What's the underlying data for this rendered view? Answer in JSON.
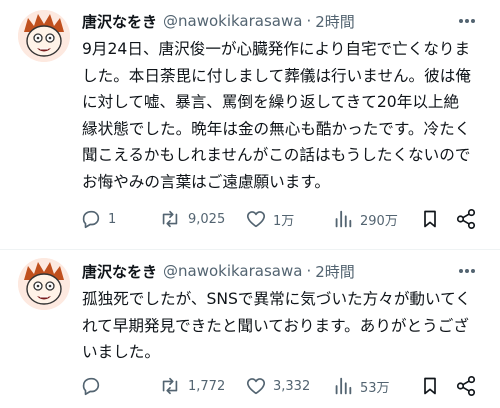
{
  "tweets": [
    {
      "name": "唐沢なをき",
      "handle": "@nawokikarasawa",
      "separator": "·",
      "time": "2時間",
      "text": "9月24日、唐沢俊一が心臓発作により自宅で亡くなりました。本日荼毘に付しまして葬儀は行いません。彼は俺に対して嘘、暴言、罵倒を繰り返してきて20年以上絶縁状態でした。晩年は金の無心も酷かったです。冷たく聞こえるかもしれませんがこの話はもうしたくないのでお悔やみの言葉はご遠慮願います。",
      "lines": [
        "9月24日、唐沢俊一が心臓発作により自宅で亡くなりま",
        "した。本日荼毘に付しまして葬儀は行いません。彼は俺",
        "に対して嘘、暴言、罵倒を繰り返してきて20年以上絶",
        "縁状態でした。晩年は金の無心も酷かったです。冷たく",
        "聞こえるかもしれませんがこの話はもうしたくないので",
        "お悔やみの言葉はご遠慮願います。"
      ],
      "replies": "1",
      "retweets": "9,025",
      "likes": "1万",
      "views": "290万"
    },
    {
      "name": "唐沢なをき",
      "handle": "@nawokikarasawa",
      "separator": "·",
      "time": "2時間",
      "lines": [
        "孤独死でしたが、SNSで異常に気づいた方々が動いてく",
        "れて早期発見できたと聞いております。ありがとうござ",
        "いました。"
      ],
      "replies": "",
      "retweets": "1,772",
      "likes": "3,332",
      "views": "53万"
    }
  ],
  "icons": [
    "reply-icon",
    "retweet-icon",
    "like-icon",
    "views-icon",
    "bookmark-icon",
    "share-icon",
    "more-icon"
  ],
  "colors": {
    "text": "#0f1419",
    "secondary": "#536471",
    "divider": "#eff3f4",
    "avatar_hair": "#c0501e",
    "avatar_face": "#fff3e8"
  }
}
